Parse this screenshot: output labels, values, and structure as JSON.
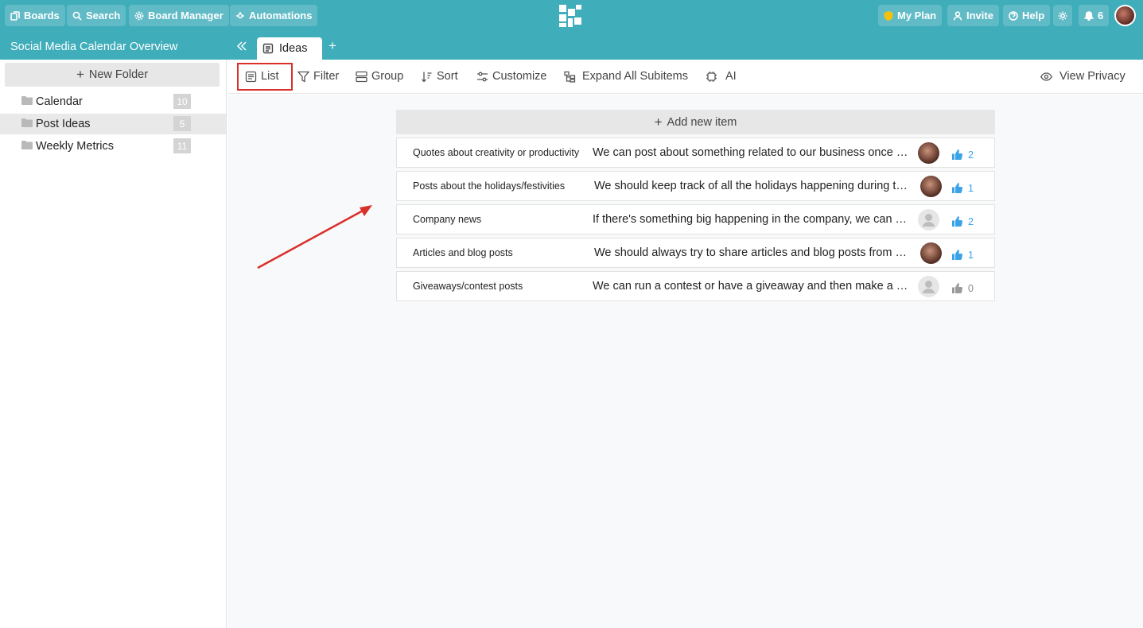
{
  "topbar": {
    "boards_label": "Boards",
    "search_label": "Search",
    "board_manager_label": "Board Manager",
    "automations_label": "Automations",
    "my_plan_label": "My Plan",
    "invite_label": "Invite",
    "help_label": "Help",
    "notifications_count": "6"
  },
  "board": {
    "title": "Social Media Calendar Overview",
    "tabs": [
      {
        "label": "Ideas"
      }
    ],
    "add_tab_label": "+"
  },
  "sidebar": {
    "new_folder_label": "New Folder",
    "folders": [
      {
        "label": "Calendar",
        "count": "10"
      },
      {
        "label": "Post Ideas",
        "count": "5"
      },
      {
        "label": "Weekly Metrics",
        "count": "11"
      }
    ]
  },
  "toolbar": {
    "list_label": "List",
    "filter_label": "Filter",
    "group_label": "Group",
    "sort_label": "Sort",
    "customize_label": "Customize",
    "expand_label": "Expand All Subitems",
    "ai_label": "AI",
    "view_privacy_label": "View Privacy"
  },
  "main": {
    "add_item_label": "Add new item",
    "items": [
      {
        "title": "Quotes about creativity or productivity",
        "description": "We can post about something related to our business once a week.",
        "likes": "2",
        "liked": true
      },
      {
        "title": "Posts about the holidays/festivities",
        "description": "We should keep track of all the holidays happening during the year.",
        "likes": "1",
        "liked": true
      },
      {
        "title": "Company news",
        "description": "If there's something big happening in the company, we can share it.",
        "likes": "2",
        "liked": true
      },
      {
        "title": "Articles and blog posts",
        "description": "We should always try to share articles and blog posts from our site.",
        "likes": "1",
        "liked": true
      },
      {
        "title": "Giveaways/contest posts",
        "description": "We can run a contest or have a giveaway and then make a post.",
        "likes": "0",
        "liked": false
      }
    ]
  },
  "colors": {
    "header": "#3fadba",
    "highlight": "#d9302c",
    "like_active": "#3aa3e8"
  }
}
